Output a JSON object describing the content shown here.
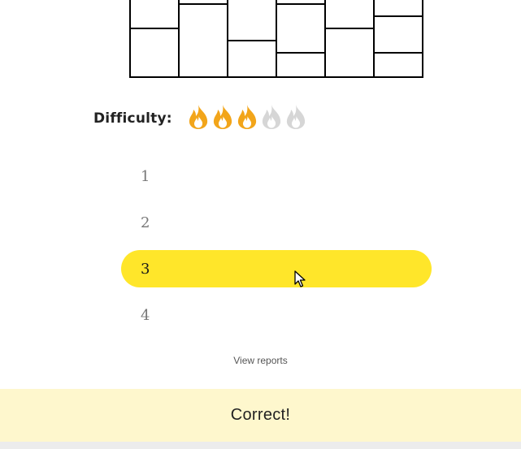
{
  "difficulty": {
    "label": "Difficulty:",
    "level": 3,
    "max": 5,
    "active_color": "#f2a51a",
    "inactive_color": "#d6d6d6",
    "icon": "flame-icon"
  },
  "options": [
    {
      "label": "1",
      "selected": false
    },
    {
      "label": "2",
      "selected": false
    },
    {
      "label": "3",
      "selected": true
    },
    {
      "label": "4",
      "selected": false
    }
  ],
  "view_reports": "View reports",
  "feedback": {
    "text": "Correct!",
    "color": "#fef7cd"
  },
  "colors": {
    "selected_option": "#ffe62a"
  }
}
